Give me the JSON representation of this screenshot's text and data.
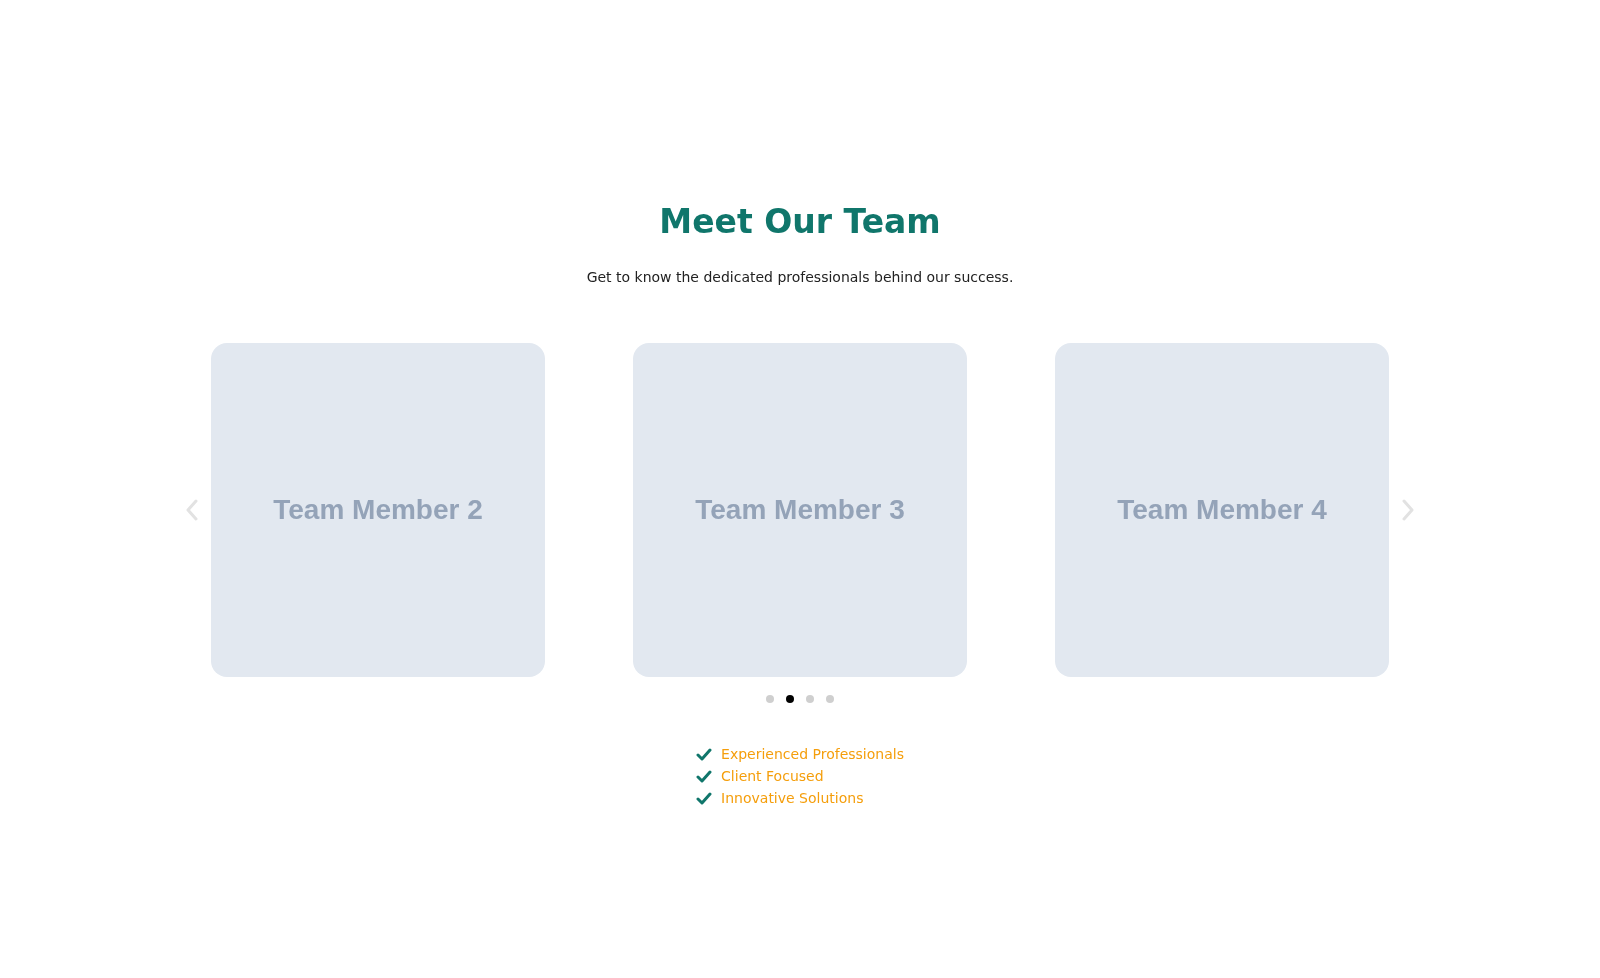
{
  "heading": "Meet Our Team",
  "subtitle": "Get to know the dedicated professionals behind our success.",
  "cards": [
    {
      "label": "Team Member 2"
    },
    {
      "label": "Team Member 3"
    },
    {
      "label": "Team Member 4"
    }
  ],
  "dots": [
    {
      "selected": false
    },
    {
      "selected": true
    },
    {
      "selected": false
    },
    {
      "selected": false
    }
  ],
  "features": [
    "Experienced Professionals",
    "Client Focused",
    "Innovative Solutions"
  ]
}
